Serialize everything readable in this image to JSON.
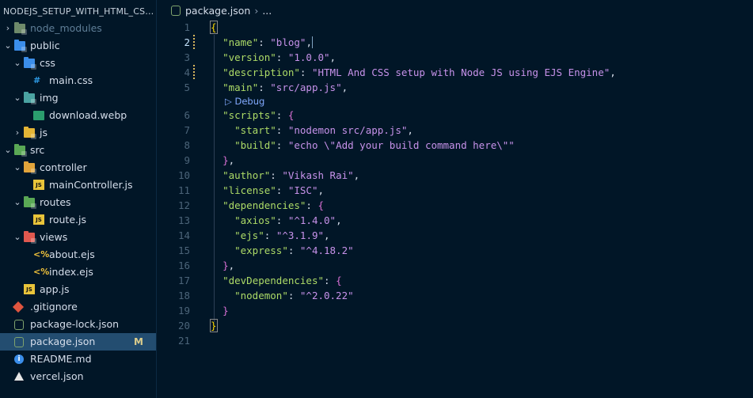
{
  "explorer": {
    "title": "NODEJS_SETUP_WITH_HTML_CSS_J...",
    "items": [
      {
        "label": "node_modules",
        "indent": 0,
        "chevron": "›",
        "icon": "folder-gray",
        "dim": true
      },
      {
        "label": "public",
        "indent": 0,
        "chevron": "⌄",
        "icon": "folder-blue"
      },
      {
        "label": "css",
        "indent": 1,
        "chevron": "⌄",
        "icon": "folder-blue"
      },
      {
        "label": "main.css",
        "indent": 2,
        "icon": "css"
      },
      {
        "label": "img",
        "indent": 1,
        "chevron": "⌄",
        "icon": "folder-teal"
      },
      {
        "label": "download.webp",
        "indent": 2,
        "icon": "image"
      },
      {
        "label": "js",
        "indent": 1,
        "chevron": "›",
        "icon": "folder-yellow"
      },
      {
        "label": "src",
        "indent": 0,
        "chevron": "⌄",
        "icon": "folder-green"
      },
      {
        "label": "controller",
        "indent": 1,
        "chevron": "⌄",
        "icon": "folder-orange"
      },
      {
        "label": "mainController.js",
        "indent": 2,
        "icon": "js"
      },
      {
        "label": "routes",
        "indent": 1,
        "chevron": "⌄",
        "icon": "folder-green"
      },
      {
        "label": "route.js",
        "indent": 2,
        "icon": "js"
      },
      {
        "label": "views",
        "indent": 1,
        "chevron": "⌄",
        "icon": "folder-red"
      },
      {
        "label": "about.ejs",
        "indent": 2,
        "icon": "ejs"
      },
      {
        "label": "index.ejs",
        "indent": 2,
        "icon": "ejs"
      },
      {
        "label": "app.js",
        "indent": 1,
        "icon": "js"
      },
      {
        "label": ".gitignore",
        "indent": 0,
        "icon": "git"
      },
      {
        "label": "package-lock.json",
        "indent": 0,
        "icon": "node"
      },
      {
        "label": "package.json",
        "indent": 0,
        "icon": "node",
        "selected": true,
        "badge": "M"
      },
      {
        "label": "README.md",
        "indent": 0,
        "icon": "info"
      },
      {
        "label": "vercel.json",
        "indent": 0,
        "icon": "triangle"
      }
    ]
  },
  "breadcrumb": {
    "file": "package.json",
    "rest": "..."
  },
  "editor": {
    "active_line": 2,
    "codelens": "Debug",
    "lines": [
      {
        "n": "1",
        "t": [
          [
            "b",
            "{"
          ]
        ]
      },
      {
        "n": "2",
        "t": [
          [
            "p",
            "  "
          ],
          [
            "k",
            "\"name\""
          ],
          [
            "p",
            ": "
          ],
          [
            "s",
            "\"blog\""
          ],
          [
            "p",
            ","
          ]
        ],
        "cursor": true
      },
      {
        "n": "3",
        "t": [
          [
            "p",
            "  "
          ],
          [
            "k",
            "\"version\""
          ],
          [
            "p",
            ": "
          ],
          [
            "s",
            "\"1.0.0\""
          ],
          [
            "p",
            ","
          ]
        ]
      },
      {
        "n": "4",
        "t": [
          [
            "p",
            "  "
          ],
          [
            "k",
            "\"description\""
          ],
          [
            "p",
            ": "
          ],
          [
            "s",
            "\"HTML And CSS setup with Node JS using EJS Engine\""
          ],
          [
            "p",
            ","
          ]
        ]
      },
      {
        "n": "5",
        "t": [
          [
            "p",
            "  "
          ],
          [
            "k",
            "\"main\""
          ],
          [
            "p",
            ": "
          ],
          [
            "s",
            "\"src/app.js\""
          ],
          [
            "p",
            ","
          ]
        ]
      },
      {
        "lens": true
      },
      {
        "n": "6",
        "t": [
          [
            "p",
            "  "
          ],
          [
            "k",
            "\"scripts\""
          ],
          [
            "p",
            ": "
          ],
          [
            "b2",
            "{"
          ]
        ]
      },
      {
        "n": "7",
        "t": [
          [
            "p",
            "    "
          ],
          [
            "k",
            "\"start\""
          ],
          [
            "p",
            ": "
          ],
          [
            "s",
            "\"nodemon src/app.js\""
          ],
          [
            "p",
            ","
          ]
        ]
      },
      {
        "n": "8",
        "t": [
          [
            "p",
            "    "
          ],
          [
            "k",
            "\"build\""
          ],
          [
            "p",
            ": "
          ],
          [
            "s",
            "\"echo \\\"Add your build command here\\\"\""
          ]
        ]
      },
      {
        "n": "9",
        "t": [
          [
            "p",
            "  "
          ],
          [
            "b2",
            "}"
          ],
          [
            "p",
            ","
          ]
        ]
      },
      {
        "n": "10",
        "t": [
          [
            "p",
            "  "
          ],
          [
            "k",
            "\"author\""
          ],
          [
            "p",
            ": "
          ],
          [
            "s",
            "\"Vikash Rai\""
          ],
          [
            "p",
            ","
          ]
        ]
      },
      {
        "n": "11",
        "t": [
          [
            "p",
            "  "
          ],
          [
            "k",
            "\"license\""
          ],
          [
            "p",
            ": "
          ],
          [
            "s",
            "\"ISC\""
          ],
          [
            "p",
            ","
          ]
        ]
      },
      {
        "n": "12",
        "t": [
          [
            "p",
            "  "
          ],
          [
            "k",
            "\"dependencies\""
          ],
          [
            "p",
            ": "
          ],
          [
            "b2",
            "{"
          ]
        ]
      },
      {
        "n": "13",
        "t": [
          [
            "p",
            "    "
          ],
          [
            "k",
            "\"axios\""
          ],
          [
            "p",
            ": "
          ],
          [
            "s",
            "\"^1.4.0\""
          ],
          [
            "p",
            ","
          ]
        ]
      },
      {
        "n": "14",
        "t": [
          [
            "p",
            "    "
          ],
          [
            "k",
            "\"ejs\""
          ],
          [
            "p",
            ": "
          ],
          [
            "s",
            "\"^3.1.9\""
          ],
          [
            "p",
            ","
          ]
        ]
      },
      {
        "n": "15",
        "t": [
          [
            "p",
            "    "
          ],
          [
            "k",
            "\"express\""
          ],
          [
            "p",
            ": "
          ],
          [
            "s",
            "\"^4.18.2\""
          ]
        ]
      },
      {
        "n": "16",
        "t": [
          [
            "p",
            "  "
          ],
          [
            "b2",
            "}"
          ],
          [
            "p",
            ","
          ]
        ]
      },
      {
        "n": "17",
        "t": [
          [
            "p",
            "  "
          ],
          [
            "k",
            "\"devDependencies\""
          ],
          [
            "p",
            ": "
          ],
          [
            "b2",
            "{"
          ]
        ]
      },
      {
        "n": "18",
        "t": [
          [
            "p",
            "    "
          ],
          [
            "k",
            "\"nodemon\""
          ],
          [
            "p",
            ": "
          ],
          [
            "s",
            "\"^2.0.22\""
          ]
        ]
      },
      {
        "n": "19",
        "t": [
          [
            "p",
            "  "
          ],
          [
            "b2",
            "}"
          ]
        ]
      },
      {
        "n": "20",
        "t": [
          [
            "b",
            "}"
          ]
        ]
      },
      {
        "n": "21",
        "t": []
      }
    ]
  }
}
